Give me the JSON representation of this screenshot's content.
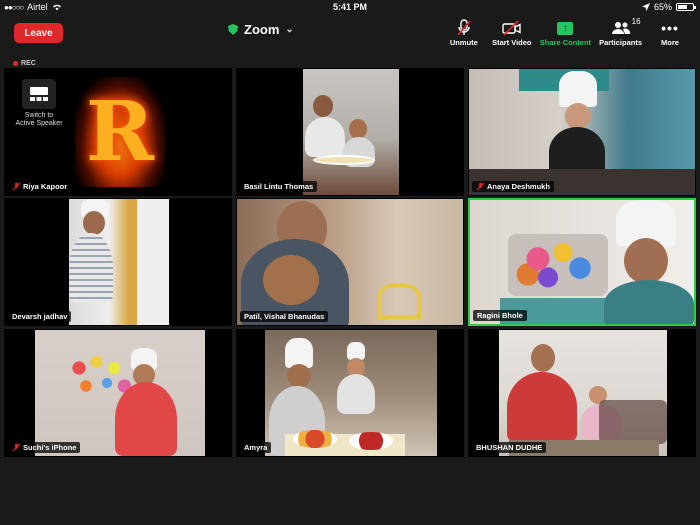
{
  "status_bar": {
    "carrier": "Airtel",
    "time": "5:41 PM",
    "battery_percent": "65%",
    "battery_level": 0.65
  },
  "toolbar": {
    "leave_label": "Leave",
    "meeting_title": "Zoom",
    "unmute_label": "Unmute",
    "start_video_label": "Start Video",
    "share_content_label": "Share Content",
    "participants_label": "Participants",
    "participants_count": "16",
    "more_label": "More"
  },
  "recording": {
    "label": "REC"
  },
  "switch_view": {
    "label": "Switch to Active Speaker"
  },
  "tiles": [
    {
      "name": "Riya Kapoor",
      "muted": true,
      "active": false
    },
    {
      "name": "Basil Lintu Thomas",
      "muted": false,
      "active": false
    },
    {
      "name": "Anaya Deshmukh",
      "muted": true,
      "active": false
    },
    {
      "name": "Devarsh jadhav",
      "muted": false,
      "active": false
    },
    {
      "name": "Patil, Vishal Bhanudas",
      "muted": false,
      "active": false
    },
    {
      "name": "Ragini Bhole",
      "muted": false,
      "active": true
    },
    {
      "name": "Suchi's iPhone",
      "muted": true,
      "active": false
    },
    {
      "name": "Amyra",
      "muted": false,
      "active": false
    },
    {
      "name": "BHUSHAN DUDHE",
      "muted": false,
      "active": false
    }
  ],
  "avatar_letter": "R"
}
